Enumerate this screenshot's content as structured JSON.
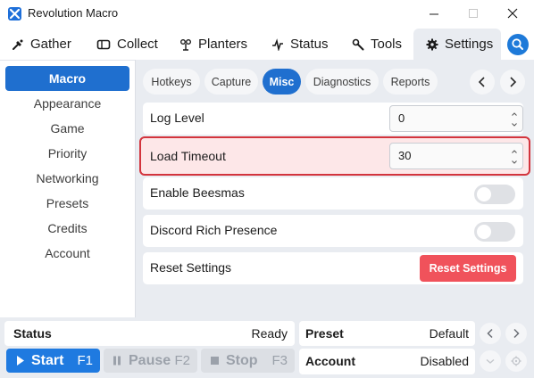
{
  "window": {
    "title": "Revolution Macro"
  },
  "nav": {
    "tabs": [
      {
        "label": "Gather",
        "icon": "gather-icon"
      },
      {
        "label": "Collect",
        "icon": "collect-icon"
      },
      {
        "label": "Planters",
        "icon": "planters-icon"
      },
      {
        "label": "Status",
        "icon": "status-icon"
      },
      {
        "label": "Tools",
        "icon": "tools-icon"
      },
      {
        "label": "Settings",
        "icon": "gear-icon",
        "active": true
      }
    ],
    "search_icon": "search-icon"
  },
  "sidebar": {
    "items": [
      "Macro",
      "Appearance",
      "Game",
      "Priority",
      "Networking",
      "Presets",
      "Credits",
      "Account"
    ],
    "active": "Macro"
  },
  "subtabs": {
    "items": [
      "Hotkeys",
      "Capture",
      "Misc",
      "Diagnostics",
      "Reports"
    ],
    "active": "Misc"
  },
  "settings": {
    "log_level": {
      "label": "Log Level",
      "value": "0"
    },
    "load_timeout": {
      "label": "Load Timeout",
      "value": "30"
    },
    "enable_beesmas": {
      "label": "Enable Beesmas",
      "enabled": false
    },
    "discord_rich_presence": {
      "label": "Discord Rich Presence",
      "enabled": false
    },
    "reset_settings": {
      "label": "Reset Settings",
      "button": "Reset Settings"
    }
  },
  "footer": {
    "status": {
      "label": "Status",
      "value": "Ready"
    },
    "preset": {
      "label": "Preset",
      "value": "Default"
    },
    "account": {
      "label": "Account",
      "value": "Disabled"
    },
    "start": {
      "label": "Start",
      "key": "F1"
    },
    "pause": {
      "label": "Pause",
      "key": "F2"
    },
    "stop": {
      "label": "Stop",
      "key": "F3"
    }
  },
  "colors": {
    "accent": "#1f6fcf",
    "danger": "#f0525b",
    "highlight_border": "#d3343d",
    "highlight_bg": "#fde7e8"
  }
}
